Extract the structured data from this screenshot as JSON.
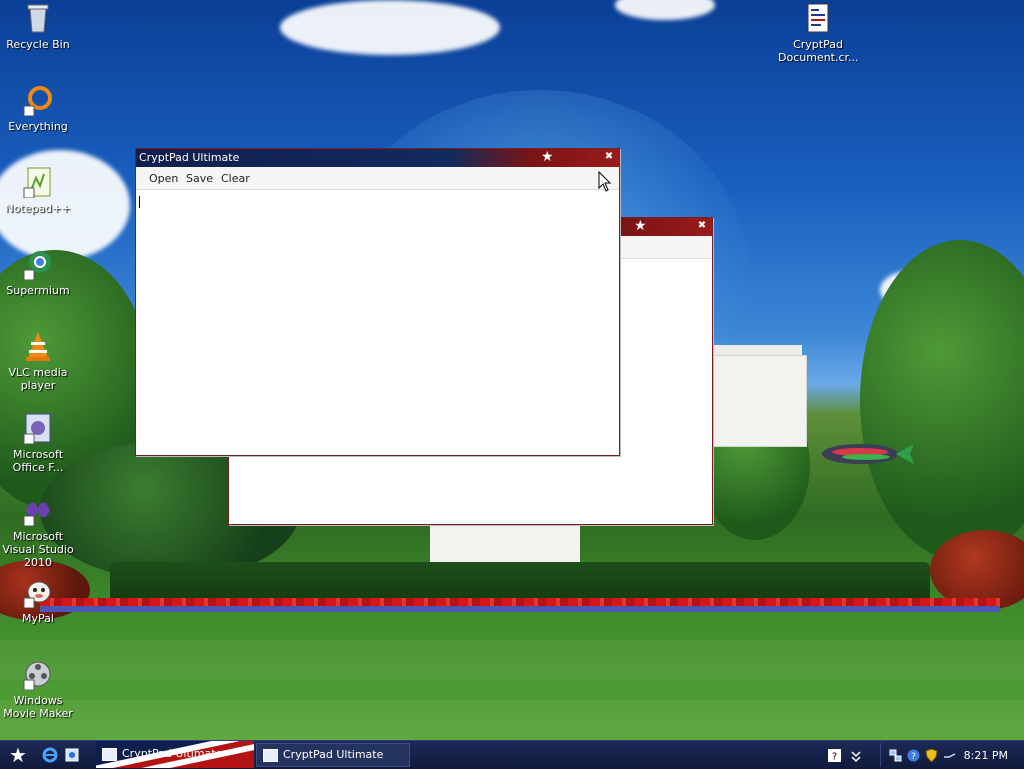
{
  "desktop": {
    "icons": [
      {
        "label": "Recycle Bin"
      },
      {
        "label": "Everything"
      },
      {
        "label": "Notepad++"
      },
      {
        "label": "Supermium"
      },
      {
        "label": "VLC media player"
      },
      {
        "label": "Microsoft Office F..."
      },
      {
        "label": "Microsoft Visual Studio 2010"
      },
      {
        "label": "MyPal"
      },
      {
        "label": "Windows Movie Maker"
      },
      {
        "label": "CryptPad Document.cr..."
      }
    ]
  },
  "windows": {
    "front": {
      "title": "CryptPad Ultimate",
      "menu": [
        "Open",
        "Save",
        "Clear"
      ]
    },
    "back": {
      "title": ""
    }
  },
  "taskbar": {
    "tasks": [
      {
        "label": "CryptPad Ultimate"
      },
      {
        "label": "CryptPad Ultimate"
      }
    ],
    "clock": "8:21 PM"
  },
  "colors": {
    "titlebar_navy": "#132a5e",
    "titlebar_red": "#9a1b1b",
    "window_border": "#7a1d1d",
    "taskbar": "#101a3d"
  },
  "icons_semantic": [
    "recycle-bin-icon",
    "everything-icon",
    "notepadpp-icon",
    "supermium-icon",
    "vlc-icon",
    "office-icon",
    "visual-studio-icon",
    "mypal-icon",
    "movie-maker-icon",
    "document-icon",
    "star-icon",
    "close-icon",
    "ie-icon",
    "tray-help-icon",
    "tray-network-icon",
    "tray-security-icon",
    "tray-volume-icon"
  ]
}
